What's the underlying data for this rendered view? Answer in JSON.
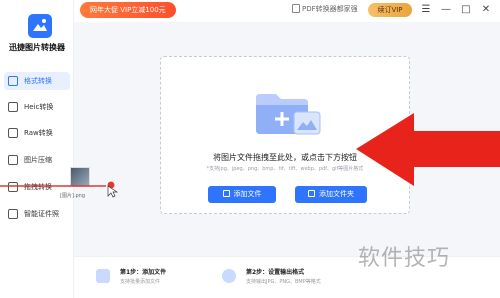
{
  "app": {
    "title": "迅捷图片转换器"
  },
  "topbar": {
    "promo": "网年大促 VIP立减100元",
    "pdf_link": "PDF转换器都家强",
    "vip_button": "续订VIP",
    "controls": {
      "menu": "☰",
      "minimize": "—",
      "maximize": "□",
      "close": "✕"
    }
  },
  "sidebar": {
    "items": [
      {
        "label": "格式转换",
        "icon": "format-convert-icon",
        "active": true
      },
      {
        "label": "Heic转换",
        "icon": "heic-icon",
        "active": false
      },
      {
        "label": "Raw转换",
        "icon": "raw-icon",
        "active": false
      },
      {
        "label": "图片压缩",
        "icon": "compress-icon",
        "active": false
      },
      {
        "label": "拖拽转换",
        "icon": "batch-icon",
        "active": false
      },
      {
        "label": "智能证件照",
        "icon": "id-photo-icon",
        "active": false
      }
    ]
  },
  "main": {
    "drop_title": "将图片文件拖拽至此处，或点击下方按钮",
    "drop_formats": "*支持jpg、jpeg、png、bmp、tif、tiff、webp、pdf、gif等图片格式",
    "add_file_button": "添加文件",
    "add_folder_button": "添加文件夹"
  },
  "steps": [
    {
      "title": "第1步：添加文件",
      "sub": "支持批量添加文件"
    },
    {
      "title": "第2步：设置输出格式",
      "sub": "支持输出JPG、PNG、BMP等格式"
    }
  ],
  "overlay": {
    "thumb_caption": "[图片].png",
    "watermark": "软件技巧"
  },
  "colors": {
    "accent": "#2f74ff",
    "arrow": "#e8231b",
    "promo": "#ff5a34"
  }
}
